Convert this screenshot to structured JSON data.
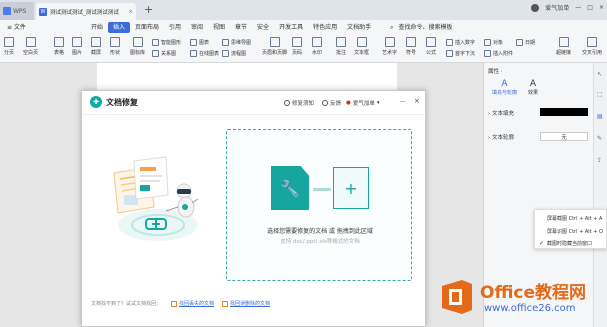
{
  "titlebar": {
    "app_tab": "WPS",
    "doc_tab_icon": "W",
    "doc_tab": "测试测试测试_测试测试测试",
    "add_tab": "+",
    "user": "爱气加单",
    "controls": [
      "—",
      "□",
      "×"
    ]
  },
  "menubar": {
    "file": "≡ 文件",
    "items": [
      "开始",
      "插入",
      "页面布局",
      "引用",
      "审阅",
      "视图",
      "章节",
      "安全",
      "开发工具",
      "特色应用",
      "文档助手"
    ],
    "active": "插入",
    "search": "查找命令、搜索模板"
  },
  "ribbon": {
    "big": [
      "分页",
      "空白页",
      "表格",
      "图片",
      "截屏",
      "形状",
      "图标库",
      "功能图",
      "智能图形",
      "在线图表",
      "思维导图",
      "流程图",
      "页眉和页脚",
      "页码",
      "水印",
      "批注",
      "文本框",
      "艺术字",
      "符号",
      "公式",
      "插入附件",
      "对象",
      "日期",
      "超链接",
      "交叉引用"
    ],
    "small": [
      "智能图形",
      "图表",
      "思维导图",
      "关系图",
      "在线图表",
      "流程图",
      "插入数字",
      "首字下沉",
      "文档部件",
      "插入附件",
      "对象",
      "日期"
    ]
  },
  "dialog": {
    "title": "文档修复",
    "help": "修复须知",
    "feedback": "反馈",
    "user": "爱气加单",
    "close": "×",
    "min": "—",
    "drop_main": "选择您需要修复的文档 或 拖拽到此区域",
    "drop_sub": "支持.doc/.ppt/.xls等格式的文档",
    "footer_note": "文档找不到了？试试文档找回：",
    "link1": "找回丢失的文档",
    "link2": "找回误删除的文档",
    "plus": "+",
    "wrench": "🔧"
  },
  "right_panel": {
    "title": "属性 ·",
    "tab_fill": "填充与轮廓",
    "tab_effect": "效果",
    "text_fill": "文本填充",
    "text_outline": "文本轮廓",
    "outline_value": "无"
  },
  "popup": {
    "items": [
      "屏幕截图 Ctrl + Alt + A",
      "屏幕识图 Ctrl + Alt + O",
      "截图时隐藏当前窗口"
    ]
  },
  "watermark": {
    "brand": "Office教程网",
    "url": "www.office26.com"
  },
  "colors": {
    "accent": "#3d6bd8",
    "teal": "#16a6a0",
    "brand_orange": "#e46a1a"
  }
}
